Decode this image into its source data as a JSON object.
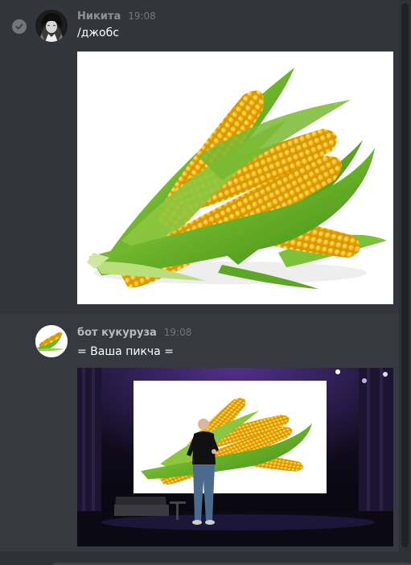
{
  "messages": [
    {
      "author": "Никита",
      "time": "19:08",
      "text": "/джобс",
      "status_icon": "check-circle-icon",
      "attachment": "corn-image"
    },
    {
      "author": "бот кукуруза",
      "time": "19:08",
      "text": "= Ваша пикча =",
      "avatar": "corn-avatar",
      "attachment": "keynote-corn-image"
    }
  ],
  "colors": {
    "background": "#36393f",
    "hover_background": "#32353b",
    "username": "#8e9297",
    "timestamp": "#72767d",
    "message_text": "#ffffff",
    "corn_kernel": "#f7b91a",
    "husk_green": "#6cb32a"
  }
}
